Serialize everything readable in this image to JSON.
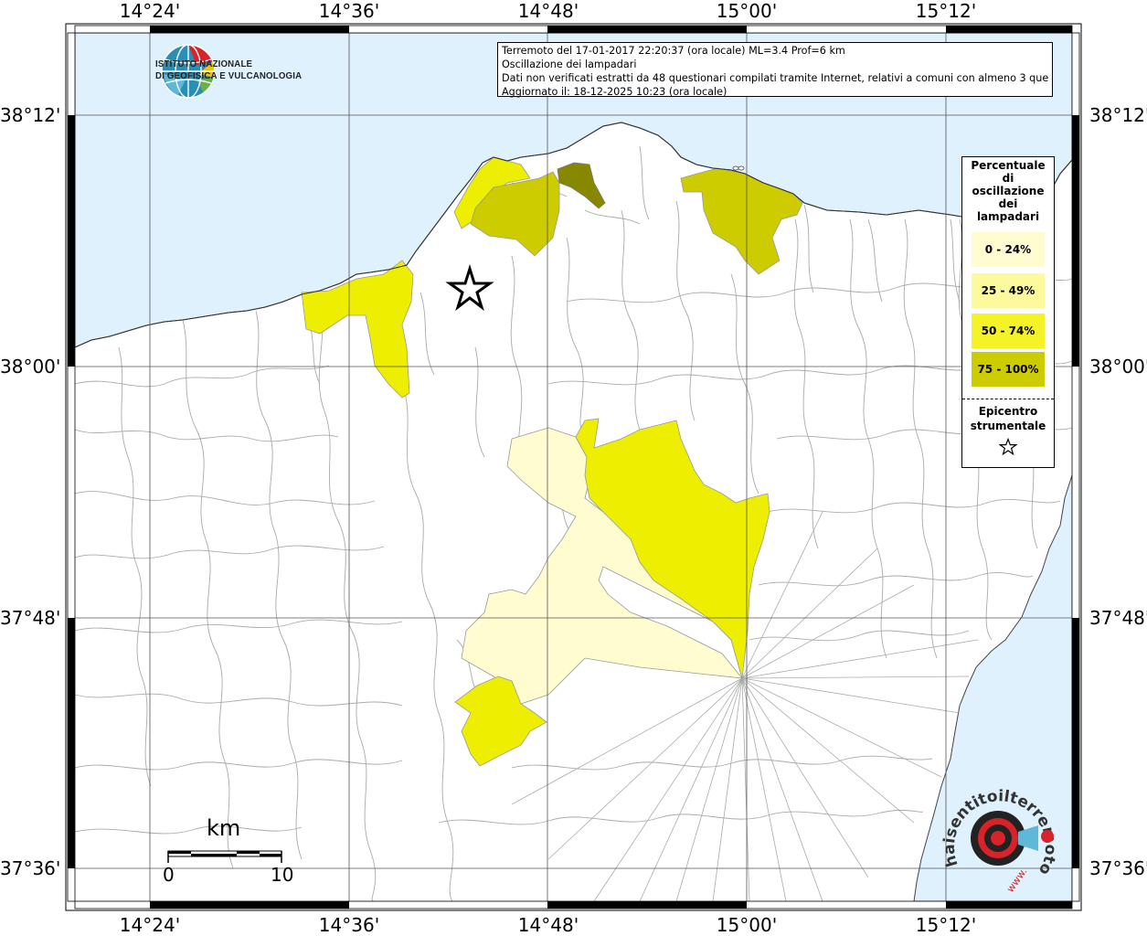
{
  "info": {
    "line1": "Terremoto del 17-01-2017 22:20:37 (ora locale) ML=3.4 Prof=6 km",
    "line2": "Oscillazione dei lampadari",
    "line3": "Dati non verificati estratti da 48 questionari compilati tramite Internet, relativi a comuni con almeno 3 questionari.",
    "line4": "Aggiornato il: 18-12-2025 10:23 (ora locale)"
  },
  "ingv": {
    "line1": "ISTITUTO NAZIONALE",
    "line2": "DI GEOFISICA E VULCANOLOGIA",
    "icon": "ingv-globe-logo"
  },
  "axes": {
    "lon_labels": [
      "14°24'",
      "14°36'",
      "14°48'",
      "15°00'",
      "15°12'"
    ],
    "lat_labels": [
      "38°12'",
      "38°00'",
      "37°48'",
      "37°36'"
    ]
  },
  "legend": {
    "title": "Percentuale di oscillazione dei lampadari",
    "items": [
      {
        "label": "0 - 24%",
        "color": "#fffdd0"
      },
      {
        "label": "25 - 49%",
        "color": "#fcfa9c"
      },
      {
        "label": "50 - 74%",
        "color": "#f3f328"
      },
      {
        "label": "75 - 100%",
        "color": "#cccc00"
      }
    ],
    "epicenter_label": "Epicentro strumentale",
    "epicenter_icon": "star-icon"
  },
  "colors": {
    "sea": "#dff1fc",
    "land": "#ffffff",
    "class_0_24": "#fffdd0",
    "class_50_74": "#eeee00",
    "class_75_100": "#cccc00",
    "class_dark": "#888800"
  },
  "scale_bar": {
    "unit": "km",
    "start": "0",
    "end": "10"
  },
  "watermark": {
    "text": "haisentitoilterremoto.it",
    "url_text": "www.",
    "icon": "hst-target-logo"
  }
}
